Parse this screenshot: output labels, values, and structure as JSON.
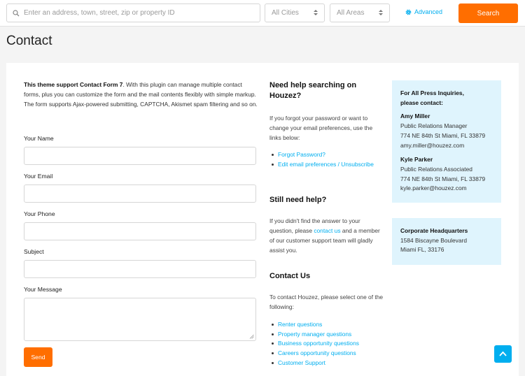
{
  "header": {
    "search_placeholder": "Enter an address, town, street, zip or property ID",
    "cities_label": "All Cities",
    "areas_label": "All Areas",
    "advanced_label": "Advanced",
    "search_button": "Search"
  },
  "page": {
    "title": "Contact"
  },
  "form": {
    "intro_bold": "This theme support Contact Form 7",
    "intro_rest": ". With this plugin can manage multiple contact forms, plus you can customize the form and the mail contents flexibly with simple markup. The form supports Ajax-powered submitting, CAPTCHA, Akismet spam filtering and so on.",
    "name_label": "Your Name",
    "email_label": "Your Email",
    "phone_label": "Your Phone",
    "subject_label": "Subject",
    "message_label": "Your Message",
    "send_button": "Send"
  },
  "help": {
    "heading": "Need help searching on Houzez?",
    "text": "If you forgot your password or want to change your email preferences, use the links below:",
    "links": [
      "Forgot Password?",
      "Edit email preferences / Unsubscribe"
    ]
  },
  "still_help": {
    "heading": "Still need help?",
    "text_before": "If you didn't find the answer to your question, please ",
    "link": "contact us",
    "text_after": " and a member of our customer support team will gladly assist you."
  },
  "contact_us": {
    "heading": "Contact Us",
    "text": "To contact Houzez, please select one of the following:",
    "links": [
      "Renter questions",
      "Property manager questions",
      "Business opportunity questions",
      "Careers opportunity questions",
      "Customer Support"
    ]
  },
  "press": {
    "heading_line1": "For All Press Inquiries,",
    "heading_line2": "please contact:",
    "contacts": [
      {
        "name": "Amy Miller",
        "role": "Public Relations Manager",
        "address": "774 NE 84th St Miami, FL 33879",
        "email": "amy.miller@houzez.com"
      },
      {
        "name": "Kyle Parker",
        "role": "Public Relations Associated",
        "address": "774 NE 84th St Miami, FL 33879",
        "email": "kyle.parker@houzez.com"
      }
    ]
  },
  "hq": {
    "heading": "Corporate Headquarters",
    "street": "1584 Biscayne Boulevard",
    "city": "Miami FL, 33176"
  },
  "colors": {
    "accent_orange": "#ff6e00",
    "link_blue": "#00aeef",
    "info_box_bg": "#dff4fd"
  }
}
